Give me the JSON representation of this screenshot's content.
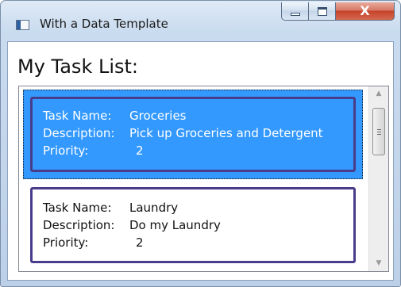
{
  "window": {
    "title": "With a Data Template",
    "caption_buttons": {
      "minimize_icon": "minimize-icon",
      "maximize_icon": "maximize-icon",
      "close_icon": "close-icon",
      "close_glyph": "X"
    }
  },
  "heading": "My Task List:",
  "labels": {
    "task_name": "Task Name:",
    "description": "Description:",
    "priority": "Priority:"
  },
  "tasks": [
    {
      "task_name": "Groceries",
      "description": "Pick up Groceries and Detergent",
      "priority": "2",
      "selected": true
    },
    {
      "task_name": "Laundry",
      "description": "Do my Laundry",
      "priority": "2",
      "selected": false
    }
  ],
  "scrollbar": {
    "up_icon": "arrow-up-icon",
    "down_icon": "arrow-down-icon",
    "up_glyph": "▲",
    "down_glyph": "▼"
  },
  "colors": {
    "selection": "#3399ff",
    "card_border": "#483d8b"
  }
}
